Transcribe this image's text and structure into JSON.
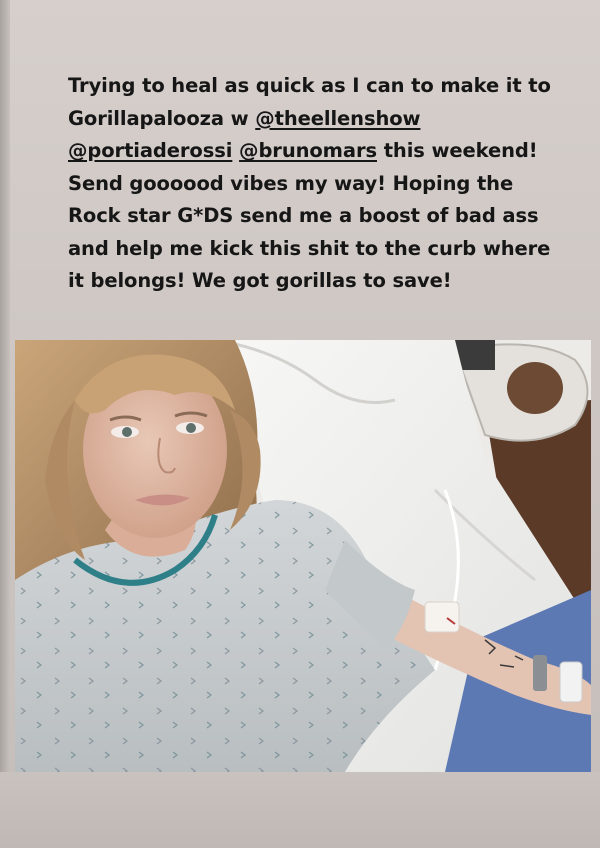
{
  "story": {
    "caption_lines": [
      [
        {
          "text": "Trying to heal as quick as I can to make it to"
        }
      ],
      [
        {
          "text": "Gorillapalooza w "
        },
        {
          "text": "@theellenshow",
          "mention": true
        }
      ],
      [
        {
          "text": "@portiaderossi",
          "mention": true
        },
        {
          "text": " "
        },
        {
          "text": "@brunomars",
          "mention": true
        },
        {
          "text": " this weekend!"
        }
      ],
      [
        {
          "text": "Send goooood vibes my way! Hoping the"
        }
      ],
      [
        {
          "text": "Rock star G*DS send me a boost of bad ass"
        }
      ],
      [
        {
          "text": "and help me kick this shit to the curb where"
        }
      ],
      [
        {
          "text": "it belongs! We got gorillas to save!"
        }
      ]
    ]
  },
  "colors": {
    "background": "#cdc6c2",
    "text": "#161616",
    "gown": "#c9cdcf",
    "sheet": "#f1f1f0"
  }
}
